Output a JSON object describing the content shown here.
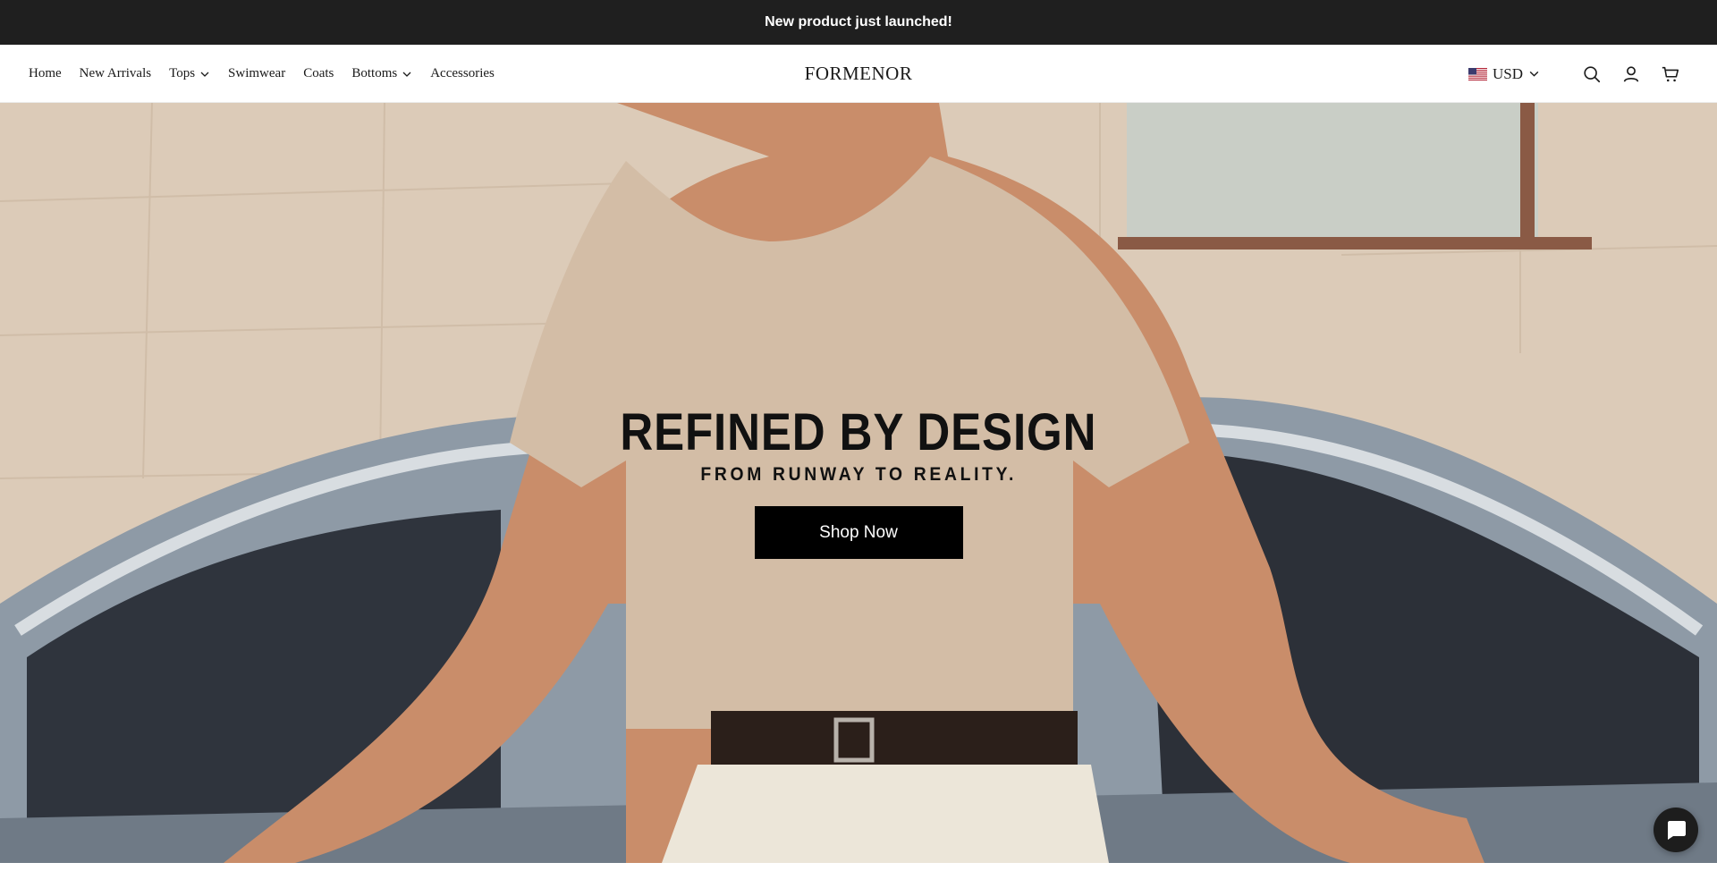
{
  "announcement": {
    "text": "New product just launched!"
  },
  "header": {
    "logo": "FORMENOR",
    "nav": [
      {
        "label": "Home",
        "dropdown": false
      },
      {
        "label": "New Arrivals",
        "dropdown": false
      },
      {
        "label": "Tops",
        "dropdown": true
      },
      {
        "label": "Swimwear",
        "dropdown": false
      },
      {
        "label": "Coats",
        "dropdown": false
      },
      {
        "label": "Bottoms",
        "dropdown": true
      },
      {
        "label": "Accessories",
        "dropdown": false
      }
    ],
    "currency": {
      "flag": "us-flag-icon",
      "label": "USD"
    },
    "icons": [
      "search-icon",
      "account-icon",
      "cart-icon"
    ]
  },
  "hero": {
    "title": "REFINED BY DESIGN",
    "subtitle": "FROM RUNWAY TO REALITY.",
    "cta_label": "Shop Now"
  },
  "chat": {
    "icon": "chat-icon"
  },
  "colors": {
    "announcement_bg": "#1f1f1f",
    "cta_bg": "#000000",
    "text": "#1a1a1a"
  }
}
